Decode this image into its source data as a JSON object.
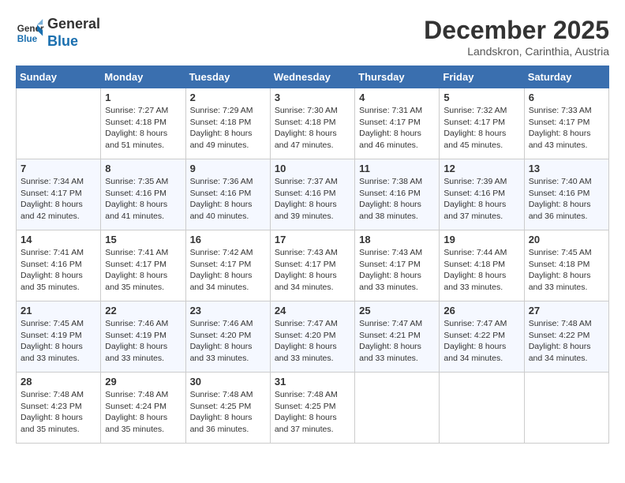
{
  "header": {
    "logo_line1": "General",
    "logo_line2": "Blue",
    "month": "December 2025",
    "location": "Landskron, Carinthia, Austria"
  },
  "weekdays": [
    "Sunday",
    "Monday",
    "Tuesday",
    "Wednesday",
    "Thursday",
    "Friday",
    "Saturday"
  ],
  "weeks": [
    [
      {
        "day": "",
        "info": ""
      },
      {
        "day": "1",
        "info": "Sunrise: 7:27 AM\nSunset: 4:18 PM\nDaylight: 8 hours\nand 51 minutes."
      },
      {
        "day": "2",
        "info": "Sunrise: 7:29 AM\nSunset: 4:18 PM\nDaylight: 8 hours\nand 49 minutes."
      },
      {
        "day": "3",
        "info": "Sunrise: 7:30 AM\nSunset: 4:18 PM\nDaylight: 8 hours\nand 47 minutes."
      },
      {
        "day": "4",
        "info": "Sunrise: 7:31 AM\nSunset: 4:17 PM\nDaylight: 8 hours\nand 46 minutes."
      },
      {
        "day": "5",
        "info": "Sunrise: 7:32 AM\nSunset: 4:17 PM\nDaylight: 8 hours\nand 45 minutes."
      },
      {
        "day": "6",
        "info": "Sunrise: 7:33 AM\nSunset: 4:17 PM\nDaylight: 8 hours\nand 43 minutes."
      }
    ],
    [
      {
        "day": "7",
        "info": "Sunrise: 7:34 AM\nSunset: 4:17 PM\nDaylight: 8 hours\nand 42 minutes."
      },
      {
        "day": "8",
        "info": "Sunrise: 7:35 AM\nSunset: 4:16 PM\nDaylight: 8 hours\nand 41 minutes."
      },
      {
        "day": "9",
        "info": "Sunrise: 7:36 AM\nSunset: 4:16 PM\nDaylight: 8 hours\nand 40 minutes."
      },
      {
        "day": "10",
        "info": "Sunrise: 7:37 AM\nSunset: 4:16 PM\nDaylight: 8 hours\nand 39 minutes."
      },
      {
        "day": "11",
        "info": "Sunrise: 7:38 AM\nSunset: 4:16 PM\nDaylight: 8 hours\nand 38 minutes."
      },
      {
        "day": "12",
        "info": "Sunrise: 7:39 AM\nSunset: 4:16 PM\nDaylight: 8 hours\nand 37 minutes."
      },
      {
        "day": "13",
        "info": "Sunrise: 7:40 AM\nSunset: 4:16 PM\nDaylight: 8 hours\nand 36 minutes."
      }
    ],
    [
      {
        "day": "14",
        "info": "Sunrise: 7:41 AM\nSunset: 4:16 PM\nDaylight: 8 hours\nand 35 minutes."
      },
      {
        "day": "15",
        "info": "Sunrise: 7:41 AM\nSunset: 4:17 PM\nDaylight: 8 hours\nand 35 minutes."
      },
      {
        "day": "16",
        "info": "Sunrise: 7:42 AM\nSunset: 4:17 PM\nDaylight: 8 hours\nand 34 minutes."
      },
      {
        "day": "17",
        "info": "Sunrise: 7:43 AM\nSunset: 4:17 PM\nDaylight: 8 hours\nand 34 minutes."
      },
      {
        "day": "18",
        "info": "Sunrise: 7:43 AM\nSunset: 4:17 PM\nDaylight: 8 hours\nand 33 minutes."
      },
      {
        "day": "19",
        "info": "Sunrise: 7:44 AM\nSunset: 4:18 PM\nDaylight: 8 hours\nand 33 minutes."
      },
      {
        "day": "20",
        "info": "Sunrise: 7:45 AM\nSunset: 4:18 PM\nDaylight: 8 hours\nand 33 minutes."
      }
    ],
    [
      {
        "day": "21",
        "info": "Sunrise: 7:45 AM\nSunset: 4:19 PM\nDaylight: 8 hours\nand 33 minutes."
      },
      {
        "day": "22",
        "info": "Sunrise: 7:46 AM\nSunset: 4:19 PM\nDaylight: 8 hours\nand 33 minutes."
      },
      {
        "day": "23",
        "info": "Sunrise: 7:46 AM\nSunset: 4:20 PM\nDaylight: 8 hours\nand 33 minutes."
      },
      {
        "day": "24",
        "info": "Sunrise: 7:47 AM\nSunset: 4:20 PM\nDaylight: 8 hours\nand 33 minutes."
      },
      {
        "day": "25",
        "info": "Sunrise: 7:47 AM\nSunset: 4:21 PM\nDaylight: 8 hours\nand 33 minutes."
      },
      {
        "day": "26",
        "info": "Sunrise: 7:47 AM\nSunset: 4:22 PM\nDaylight: 8 hours\nand 34 minutes."
      },
      {
        "day": "27",
        "info": "Sunrise: 7:48 AM\nSunset: 4:22 PM\nDaylight: 8 hours\nand 34 minutes."
      }
    ],
    [
      {
        "day": "28",
        "info": "Sunrise: 7:48 AM\nSunset: 4:23 PM\nDaylight: 8 hours\nand 35 minutes."
      },
      {
        "day": "29",
        "info": "Sunrise: 7:48 AM\nSunset: 4:24 PM\nDaylight: 8 hours\nand 35 minutes."
      },
      {
        "day": "30",
        "info": "Sunrise: 7:48 AM\nSunset: 4:25 PM\nDaylight: 8 hours\nand 36 minutes."
      },
      {
        "day": "31",
        "info": "Sunrise: 7:48 AM\nSunset: 4:25 PM\nDaylight: 8 hours\nand 37 minutes."
      },
      {
        "day": "",
        "info": ""
      },
      {
        "day": "",
        "info": ""
      },
      {
        "day": "",
        "info": ""
      }
    ]
  ]
}
